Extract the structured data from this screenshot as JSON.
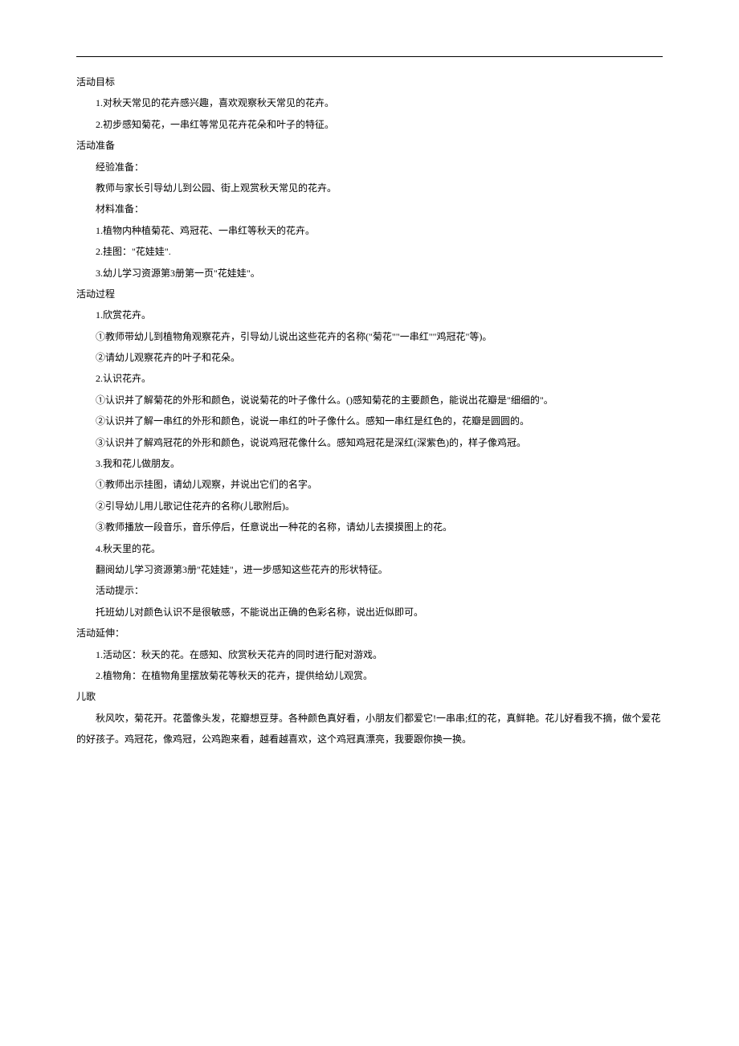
{
  "sections": {
    "goals": {
      "heading": "活动目标",
      "items": [
        "1.对秋天常见的花卉感兴趣，喜欢观察秋天常见的花卉。",
        "2.初步感知菊花，一串红等常见花卉花朵和叶子的特征。"
      ]
    },
    "preparation": {
      "heading": "活动准备",
      "expLabel": "经验准备：",
      "expText": "教师与家长引导幼儿到公园、街上观赏秋天常见的花卉。",
      "matLabel": "材料准备：",
      "matItems": [
        "1.植物内种植菊花、鸡冠花、一串红等秋天的花卉。",
        "2.挂图：\"花娃娃\".",
        "3.幼儿学习资源第3册第一页\"花娃娃\"。"
      ]
    },
    "process": {
      "heading": "活动过程",
      "blocks": [
        {
          "title": "1.欣赏花卉。",
          "lines": [
            "①教师带幼儿到植物角观察花卉，引导幼儿说出这些花卉的名称(\"菊花\"\"一串红\"\"鸡冠花\"等)。",
            "②请幼儿观察花卉的叶子和花朵。"
          ]
        },
        {
          "title": "2.认识花卉。",
          "lines": [
            "①认识并了解菊花的外形和颜色，说说菊花的叶子像什么。()感知菊花的主要颜色，能说出花瓣是\"细细的\"。",
            "②认识并了解一串红的外形和颜色，说说一串红的叶子像什么。感知一串红是红色的，花瓣是圆圆的。",
            "③认识并了解鸡冠花的外形和颜色，说说鸡冠花像什么。感知鸡冠花是深红(深紫色)的，样子像鸡冠。"
          ]
        },
        {
          "title": "3.我和花儿做朋友。",
          "lines": [
            "①教师出示挂图，请幼儿观察，并说出它们的名字。",
            "②引导幼儿用儿歌记住花卉的名称(儿歌附后)。",
            "③教师播放一段音乐，音乐停后，任意说出一种花的名称，请幼儿去摸摸图上的花。"
          ]
        },
        {
          "title": "4.秋天里的花。",
          "lines": [
            "翻阅幼儿学习资源第3册\"花娃娃\"，进一步感知这些花卉的形状特征。",
            "活动提示：",
            "托班幼儿对颜色认识不是很敏感，不能说出正确的色彩名称，说出近似即可。"
          ]
        }
      ]
    },
    "extension": {
      "heading": "活动延伸：",
      "items": [
        "1.活动区：秋天的花。在感知、欣赏秋天花卉的同时进行配对游戏。",
        "2.植物角：在植物角里摆放菊花等秋天的花卉，提供给幼儿观赏。"
      ]
    },
    "song": {
      "heading": "儿歌",
      "text": "秋风吹，菊花开。花蕾像头发，花瓣想豆芽。各种颜色真好看，小朋友们都爱它!一串串;红的花，真鲜艳。花儿好看我不摘，做个爱花的好孩子。鸡冠花，像鸡冠，公鸡跑来看，越看越喜欢，这个鸡冠真漂亮，我要跟你换一换。"
    }
  }
}
